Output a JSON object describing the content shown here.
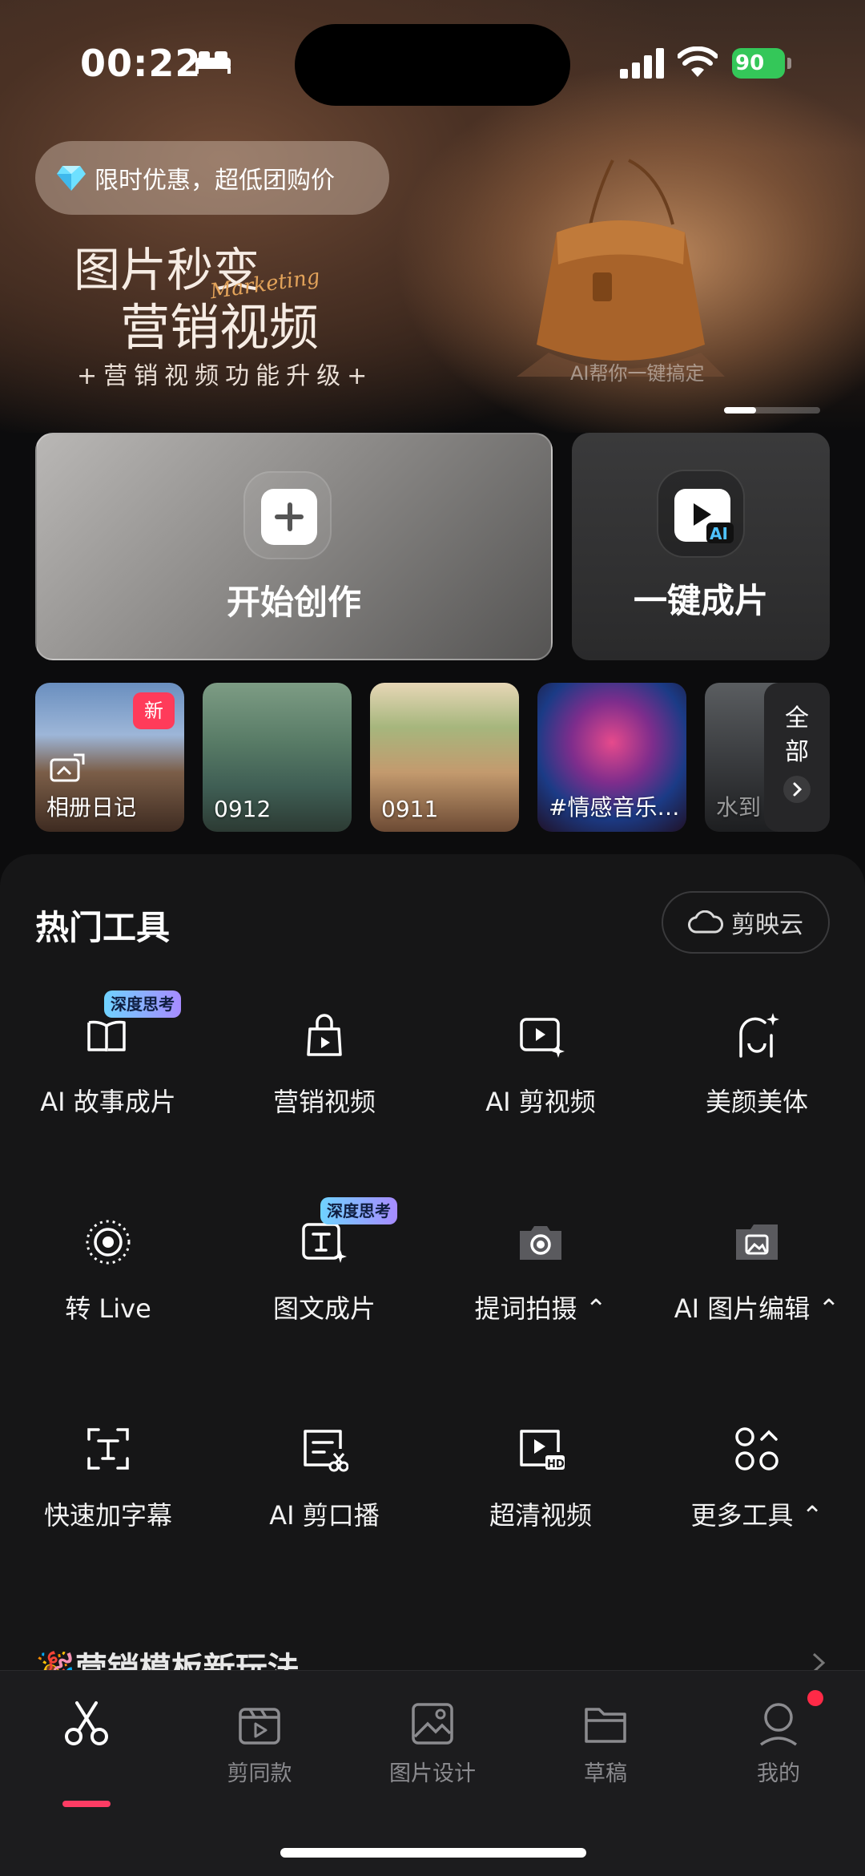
{
  "status_bar": {
    "time": "00:22",
    "battery": "90"
  },
  "banner": {
    "promo": "限时优惠，超低团购价",
    "headline_line1": "图片秒变",
    "headline_line2": "营销视频",
    "script_text": "Marketing",
    "subline": "+营销视频功能升级+",
    "caption": "AI帮你一键搞定"
  },
  "actions": {
    "create_label": "开始创作",
    "oneclick_label": "一键成片"
  },
  "drafts": [
    {
      "label": "相册日记",
      "badge": "新"
    },
    {
      "label": "0912"
    },
    {
      "label": "0911"
    },
    {
      "label": "#情感音乐…"
    },
    {
      "label": "水到"
    }
  ],
  "drafts_more": "全部",
  "tools_section": {
    "title": "热门工具",
    "cloud_label": "剪映云",
    "badge_text": "深度思考",
    "items": [
      {
        "label": "AI 故事成片",
        "icon": "book-icon",
        "badge": true
      },
      {
        "label": "营销视频",
        "icon": "shopping-bag-icon"
      },
      {
        "label": "AI 剪视频",
        "icon": "video-sparkle-icon"
      },
      {
        "label": "美颜美体",
        "icon": "beauty-icon"
      },
      {
        "label": "转 Live",
        "icon": "live-icon"
      },
      {
        "label": "图文成片",
        "icon": "text-sparkle-icon",
        "badge": true
      },
      {
        "label": "提词拍摄",
        "icon": "camera-icon",
        "chevron": true
      },
      {
        "label": "AI 图片编辑",
        "icon": "image-edit-icon",
        "chevron": true
      },
      {
        "label": "快速加字幕",
        "icon": "subtitle-icon"
      },
      {
        "label": "AI 剪口播",
        "icon": "script-cut-icon"
      },
      {
        "label": "超清视频",
        "icon": "hd-video-icon"
      },
      {
        "label": "更多工具",
        "icon": "more-tools-icon",
        "chevron": true
      }
    ]
  },
  "next_section_title": "营销模板新玩法",
  "tabbar": [
    {
      "label": "",
      "icon": "scissors-icon",
      "active": true
    },
    {
      "label": "剪同款",
      "icon": "clapper-icon"
    },
    {
      "label": "图片设计",
      "icon": "image-design-icon"
    },
    {
      "label": "草稿",
      "icon": "folder-icon"
    },
    {
      "label": "我的",
      "icon": "profile-icon",
      "dot": true
    }
  ],
  "colors": {
    "accent": "#fe3c64",
    "badge_new": "#ff3b5a",
    "battery": "#34c759"
  }
}
